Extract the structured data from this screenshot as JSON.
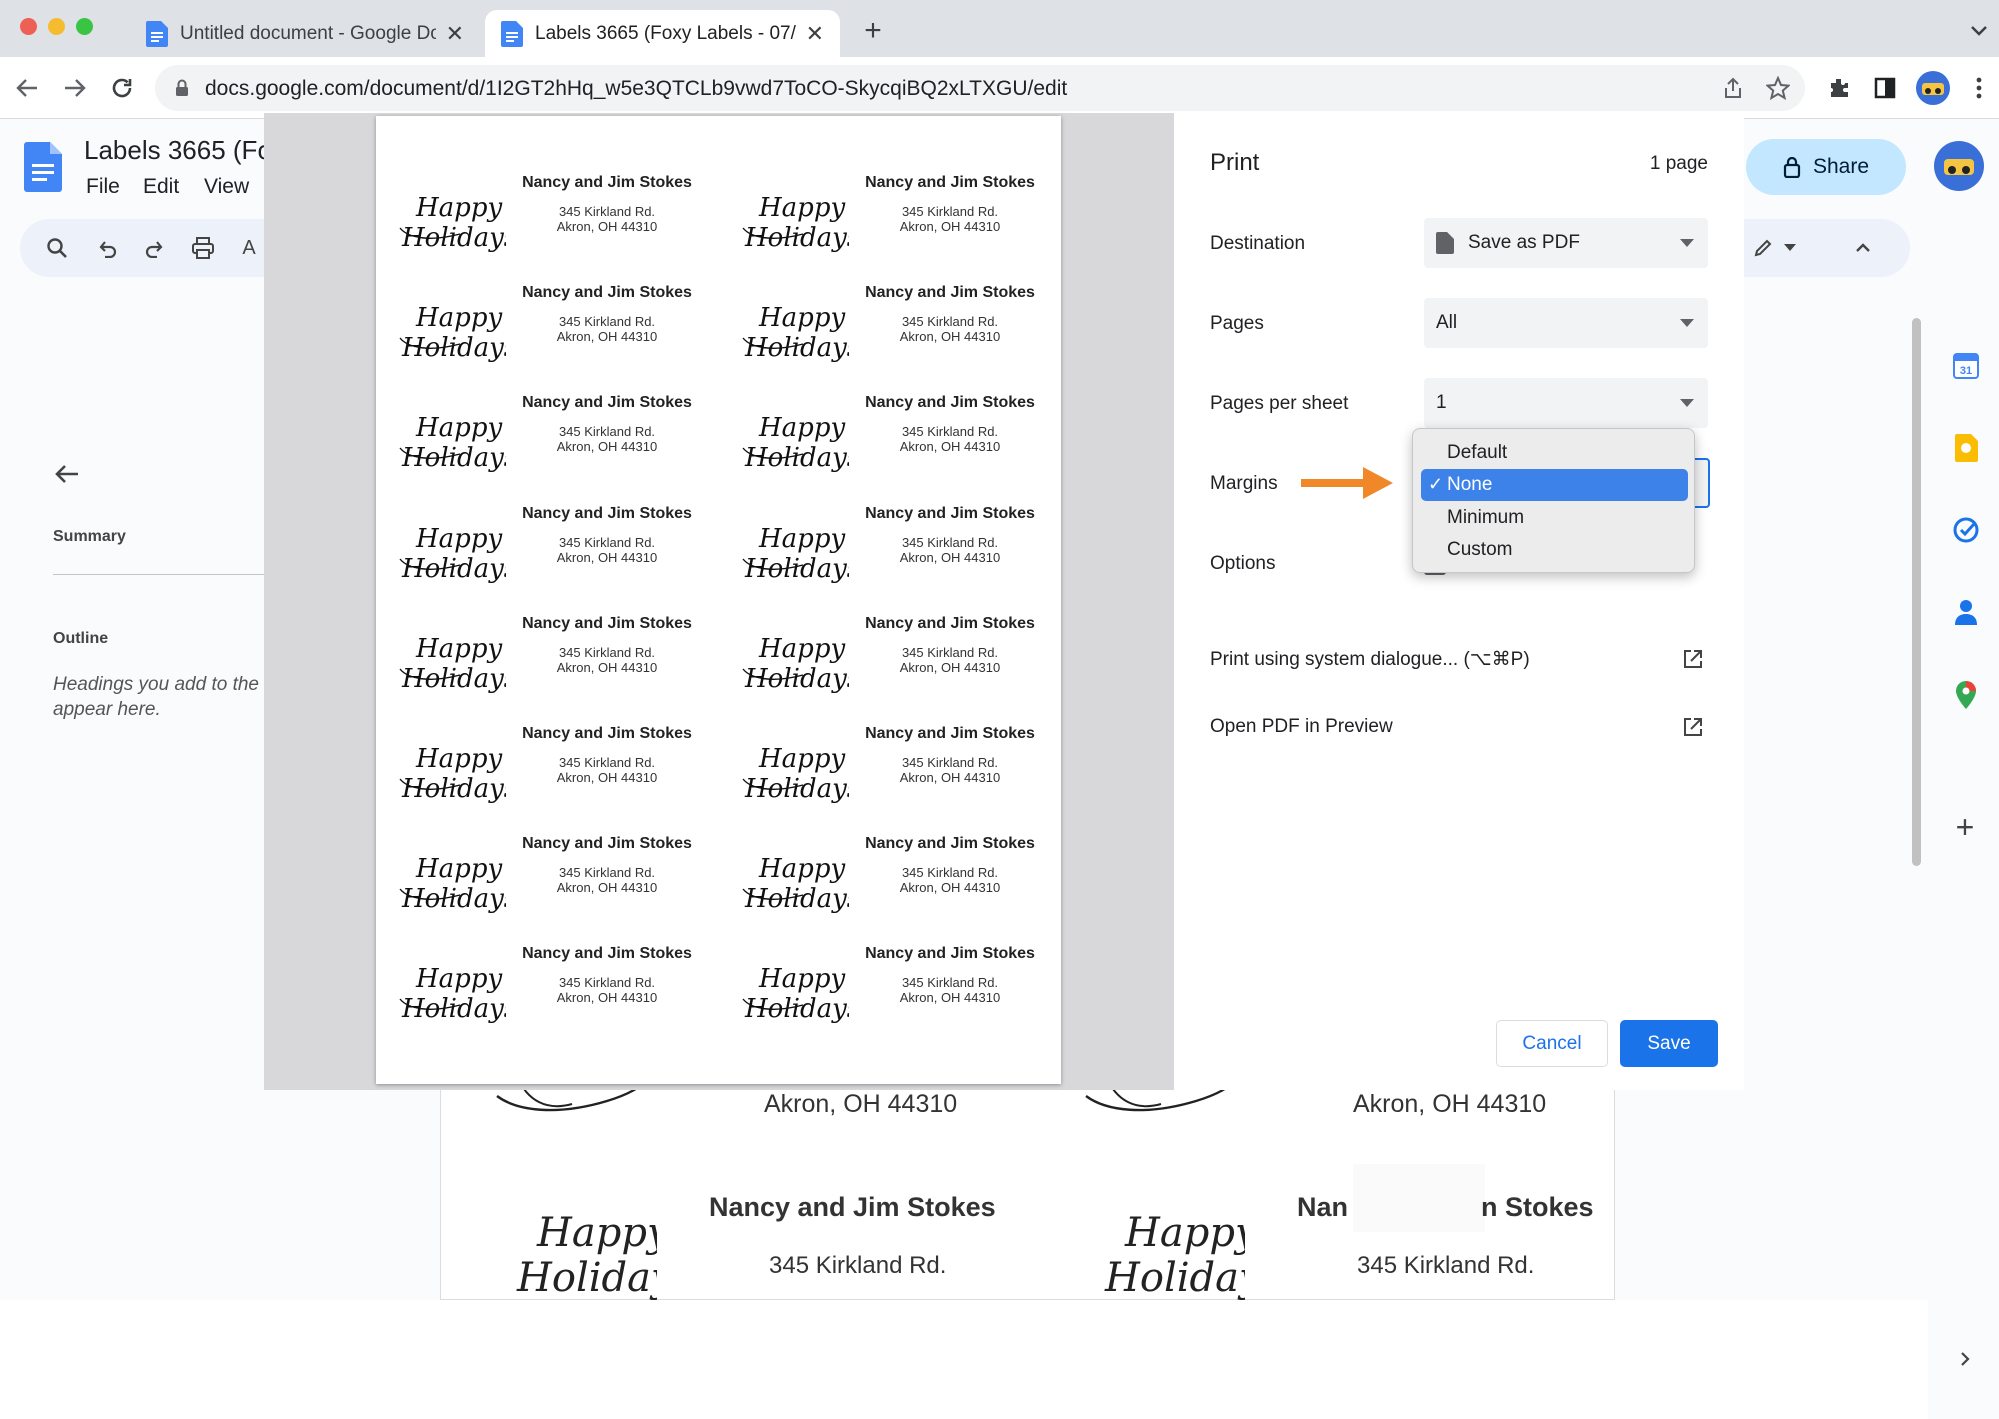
{
  "browser": {
    "tabs": [
      {
        "title": "Untitled document - Google Docs"
      },
      {
        "title": "Labels 3665 (Foxy Labels - 07/"
      }
    ],
    "url": "docs.google.com/document/d/1I2GT2hHq_w5e3QTCLb9vwd7ToCO-SkycqiBQ2xLTXGU/edit"
  },
  "docs": {
    "title": "Labels 3665 (Fo",
    "menu": [
      "File",
      "Edit",
      "View"
    ],
    "share_label": "Share",
    "left_panel": {
      "summary": "Summary",
      "outline": "Outline",
      "hint_line1": "Headings you add to the",
      "hint_line2": "appear here."
    },
    "background_labels": {
      "city1": "Akron, OH 44310",
      "city2": "Akron, OH 44310",
      "name1": "Nancy and Jim Stokes",
      "name2_left": "Nan",
      "name2_right": "n Stokes",
      "street1": "345 Kirkland Rd.",
      "street2": "345 Kirkland Rd."
    }
  },
  "label": {
    "name": "Nancy and Jim Stokes",
    "street": "345 Kirkland Rd.",
    "city": "Akron, OH 44310"
  },
  "print": {
    "title": "Print",
    "page_count": "1 page",
    "destination_label": "Destination",
    "destination_value": "Save as PDF",
    "pages_label": "Pages",
    "pages_value": "All",
    "pages_per_sheet_label": "Pages per sheet",
    "pages_per_sheet_value": "1",
    "margins_label": "Margins",
    "options_label": "Options",
    "margin_options": [
      "Default",
      "None",
      "Minimum",
      "Custom"
    ],
    "margin_selected": "None",
    "system_dialog_link": "Print using system dialogue... (⌥⌘P)",
    "open_pdf_link": "Open PDF in Preview",
    "cancel_label": "Cancel",
    "save_label": "Save"
  },
  "colors": {
    "accent_blue": "#1a73e8",
    "arrow_orange": "#f0882a"
  }
}
